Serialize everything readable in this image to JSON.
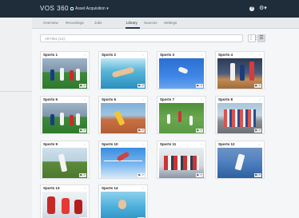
{
  "app": {
    "title": "VOS 360",
    "project": "Asset Acquisition",
    "help_icon": "help-icon",
    "settings_icon": "gear-icon"
  },
  "tabs": [
    {
      "label": "Overview",
      "active": false
    },
    {
      "label": "Recordings",
      "active": false
    },
    {
      "label": "Jobs",
      "active": false
    },
    {
      "label": "Library",
      "active": true
    },
    {
      "label": "Sources",
      "active": false
    },
    {
      "label": "Settings",
      "active": false
    }
  ],
  "search": {
    "placeholder": "All Files (14)"
  },
  "view_toggle": {
    "grid_icon": "grid-icon",
    "list_icon": "list-icon"
  },
  "cards": [
    {
      "title": "Sports 1",
      "scene": "soccer"
    },
    {
      "title": "Sports 2",
      "scene": "swimming"
    },
    {
      "title": "Sports 3",
      "scene": "skydive"
    },
    {
      "title": "Sports 4",
      "scene": "basketball"
    },
    {
      "title": "Sports 5",
      "scene": "soccer"
    },
    {
      "title": "Sports 6",
      "scene": "track"
    },
    {
      "title": "Sports 7",
      "scene": "field"
    },
    {
      "title": "Sports 8",
      "scene": "cycling"
    },
    {
      "title": "Sports 9",
      "scene": "tennis"
    },
    {
      "title": "Sports 10",
      "scene": "highjump"
    },
    {
      "title": "Sports 11",
      "scene": "crowd"
    },
    {
      "title": "Sports 12",
      "scene": "tennis2"
    },
    {
      "title": "Sports 13",
      "scene": "hockey"
    },
    {
      "title": "Sports 14",
      "scene": "waterpolo"
    }
  ],
  "card_actions": "▶ ↗",
  "colors": {
    "topbar": "#1f2c3a",
    "accent": "#2a3a4a"
  }
}
